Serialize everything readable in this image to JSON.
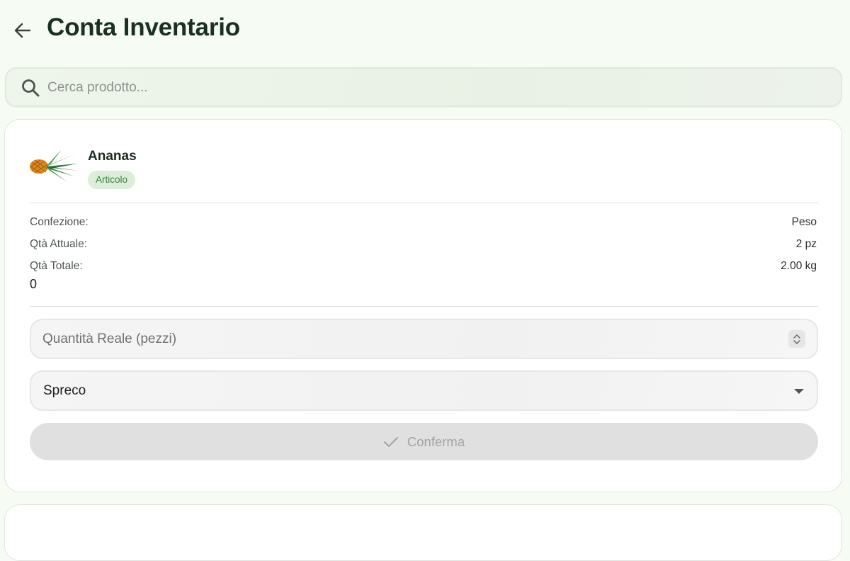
{
  "header": {
    "title": "Conta Inventario"
  },
  "search": {
    "placeholder": "Cerca prodotto..."
  },
  "product": {
    "name": "Ananas",
    "badge": "Articolo",
    "info": {
      "confezione_label": "Confezione:",
      "confezione_value": "Peso",
      "qta_attuale_label": "Qtà Attuale:",
      "qta_attuale_value": "2 pz",
      "qta_totale_label": "Qtà Totale:",
      "qta_totale_value": "2.00 kg",
      "extra_value": "0"
    },
    "quantity_field": {
      "placeholder": "Quantità Reale (pezzi)"
    },
    "reason_select": {
      "selected": "Spreco"
    },
    "confirm_label": "Conferma"
  },
  "colors": {
    "background": "#f6fcf4",
    "title": "#1b3022",
    "badge_bg": "#dbeed8",
    "badge_text": "#3d7d45",
    "button_disabled": "#e0e0e0"
  },
  "icons": {
    "back": "arrow-left-icon",
    "search": "search-icon",
    "spinner": "spinner-icon",
    "caret": "caret-down-icon",
    "check": "check-icon",
    "product": "pineapple-icon"
  }
}
